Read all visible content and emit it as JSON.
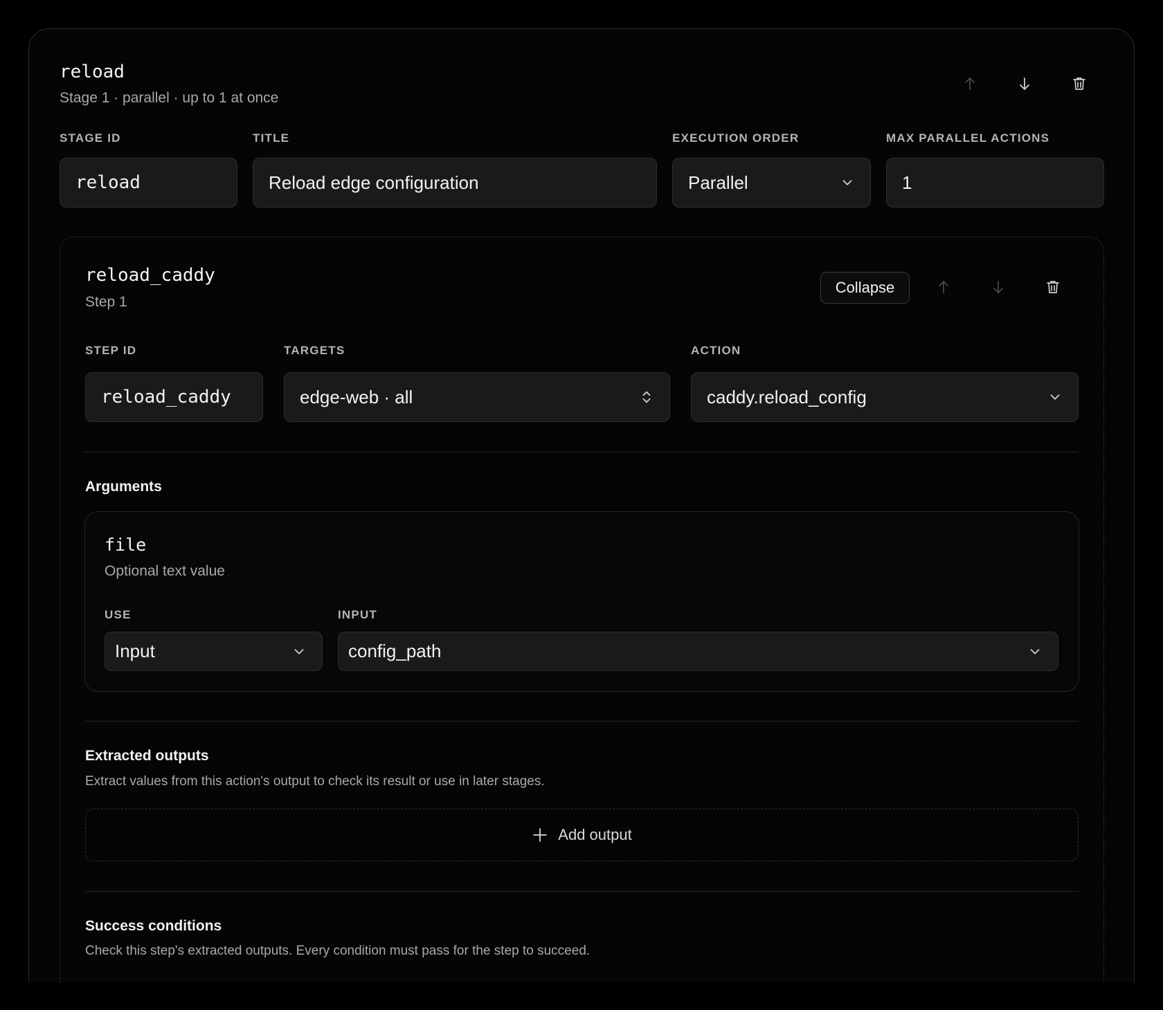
{
  "stage": {
    "name": "reload",
    "subtitle": "Stage 1 · parallel · up to 1 at once",
    "fields": {
      "stage_id_label": "STAGE ID",
      "stage_id_value": "reload",
      "title_label": "TITLE",
      "title_value": "Reload edge configuration",
      "execution_order_label": "EXECUTION ORDER",
      "execution_order_value": "Parallel",
      "max_parallel_label": "MAX PARALLEL ACTIONS",
      "max_parallel_value": "1"
    }
  },
  "step": {
    "name": "reload_caddy",
    "subtitle": "Step 1",
    "collapse_label": "Collapse",
    "fields": {
      "step_id_label": "STEP ID",
      "step_id_value": "reload_caddy",
      "targets_label": "TARGETS",
      "targets_value": "edge-web · all",
      "action_label": "ACTION",
      "action_value": "caddy.reload_config"
    },
    "arguments": {
      "title": "Arguments",
      "items": [
        {
          "name": "file",
          "description": "Optional text value",
          "use_label": "USE",
          "use_value": "Input",
          "input_label": "INPUT",
          "input_value": "config_path"
        }
      ]
    },
    "extracted_outputs": {
      "title": "Extracted outputs",
      "description": "Extract values from this action's output to check its result or use in later stages.",
      "add_label": "Add output"
    },
    "success_conditions": {
      "title": "Success conditions",
      "description": "Check this step's extracted outputs. Every condition must pass for the step to succeed."
    }
  },
  "icons": {
    "move_up": "arrow-up-icon",
    "move_down": "arrow-down-icon",
    "delete": "trash-icon",
    "dropdown": "chevron-down-icon",
    "stepper": "chevron-up-down-icon",
    "add": "plus-icon"
  }
}
